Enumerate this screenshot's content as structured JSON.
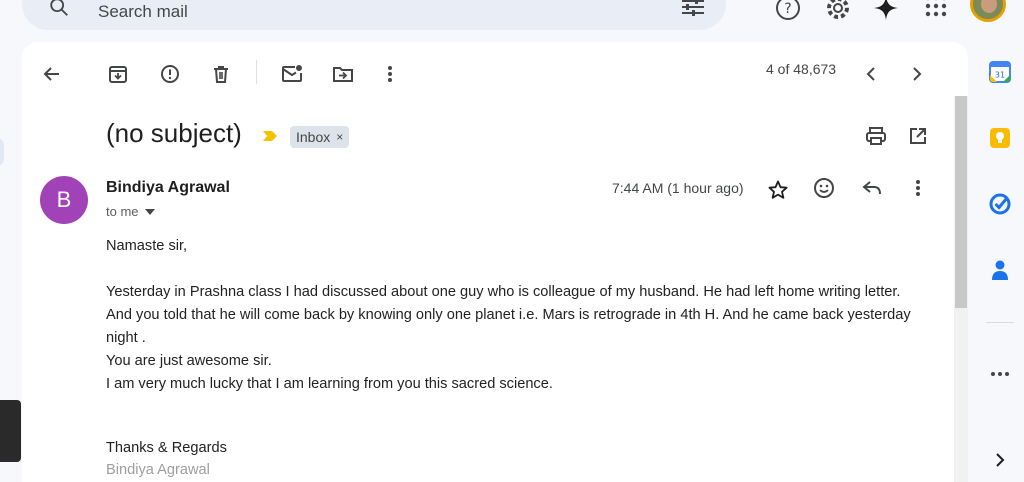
{
  "search": {
    "placeholder": "Search mail"
  },
  "toolbar": {
    "back": "back-arrow-icon",
    "archive": "archive-icon",
    "report": "report-spam-icon",
    "delete": "delete-icon",
    "mark_unread": "mark-unread-icon",
    "move": "move-to-icon",
    "more": "more-vert-icon",
    "pager": "4 of 48,673"
  },
  "message": {
    "subject": "(no subject)",
    "label": "Inbox",
    "label_close": "×",
    "sender_initial": "B",
    "sender_name": "Bindiya Agrawal",
    "recipient": "to me",
    "timestamp": "7:44 AM (1 hour ago)",
    "body": [
      "Namaste sir,",
      "",
      "Yesterday in Prashna class I had discussed about one guy who is colleague of my husband. He had left home writing letter. And you told that he will come back by knowing only one planet i.e. Mars is retrograde in 4th H. And he came back yesterday night .",
      "You are just awesome sir.",
      "I am very much lucky that I am learning from you this sacred science."
    ],
    "signoff": "Thanks & Regards",
    "signature": "Bindiya Agrawal"
  },
  "side_panel": {
    "calendar_day": "31"
  },
  "colors": {
    "avatar": "#a142b9",
    "accent_blue": "#0b57d0",
    "label_bg": "#dde3ea",
    "importance": "#f2c300",
    "keep": "#f9bb04"
  }
}
